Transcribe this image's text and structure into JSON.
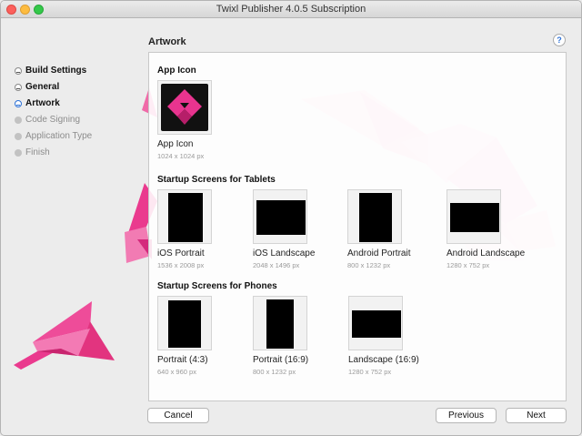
{
  "window": {
    "title": "Twixl Publisher 4.0.5 Subscription"
  },
  "sidebar": {
    "items": [
      {
        "label": "Build Settings",
        "state": "done"
      },
      {
        "label": "General",
        "state": "done"
      },
      {
        "label": "Artwork",
        "state": "current"
      },
      {
        "label": "Code Signing",
        "state": "pending"
      },
      {
        "label": "Application Type",
        "state": "pending"
      },
      {
        "label": "Finish",
        "state": "pending"
      }
    ]
  },
  "page": {
    "title": "Artwork",
    "help_label": "?"
  },
  "app_icon": {
    "section_title": "App Icon",
    "label": "App Icon",
    "size": "1024 x 1024 px"
  },
  "tablets": {
    "section_title": "Startup Screens for Tablets",
    "items": [
      {
        "label": "iOS Portrait",
        "size": "1536 x 2008 px"
      },
      {
        "label": "iOS Landscape",
        "size": "2048 x 1496 px"
      },
      {
        "label": "Android Portrait",
        "size": "800 x 1232 px"
      },
      {
        "label": "Android Landscape",
        "size": "1280 x 752 px"
      }
    ]
  },
  "phones": {
    "section_title": "Startup Screens for Phones",
    "items": [
      {
        "label": "Portrait (4:3)",
        "size": "640 x 960 px"
      },
      {
        "label": "Portrait (16:9)",
        "size": "800 x 1232 px"
      },
      {
        "label": "Landscape (16:9)",
        "size": "1280 x 752 px"
      }
    ]
  },
  "buttons": {
    "cancel": "Cancel",
    "previous": "Previous",
    "next": "Next"
  },
  "colors": {
    "brand_pink": "#e8348f",
    "accent_blue": "#2a6fd6"
  }
}
